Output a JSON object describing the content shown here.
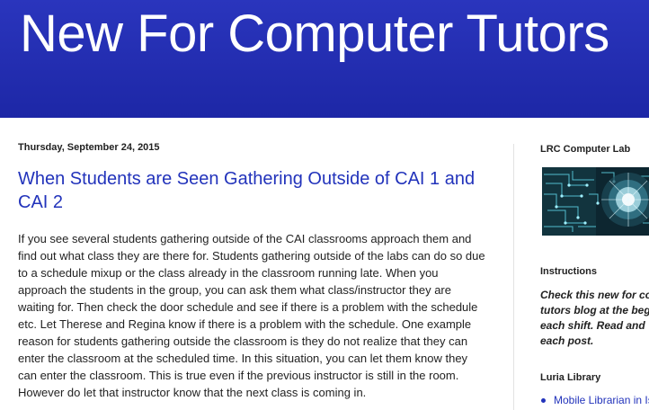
{
  "header": {
    "title": "New For Computer Tutors"
  },
  "post": {
    "date": "Thursday, September 24, 2015",
    "title": "When Students are Seen Gathering Outside of CAI 1 and CAI 2",
    "body": "If you see several students gathering outside of the CAI classrooms approach them and find out what class they are there for. Students gathering outside of the labs can do so due to a schedule mixup or the class already in the classroom running late. When you approach the students in the group, you can ask them what class/instructor they are waiting for. Then check the door schedule and see if there is a problem with the schedule etc. Let Therese and Regina know if there is a problem with the schedule. One example reason for students gathering outside the classroom is they do not realize that they can enter the classroom at the scheduled time. In this situation, you can let them know they can enter the classroom. This is true even if the previous instructor is still in the room. However do let that instructor know that the next class is coming in."
  },
  "sidebar": {
    "lab_widget": {
      "title": "LRC Computer Lab",
      "image_icon": "circuit-board-image"
    },
    "instructions": {
      "title": "Instructions",
      "text": "Check this new for co\ntutors blog at the beg\neach shift. Read and \neach post."
    },
    "luria": {
      "title": "Luria Library",
      "items": [
        {
          "label": "Mobile Librarian in Is"
        }
      ]
    }
  },
  "colors": {
    "header_bg": "#1f2aad",
    "link": "#2233bb",
    "text": "#222222"
  }
}
